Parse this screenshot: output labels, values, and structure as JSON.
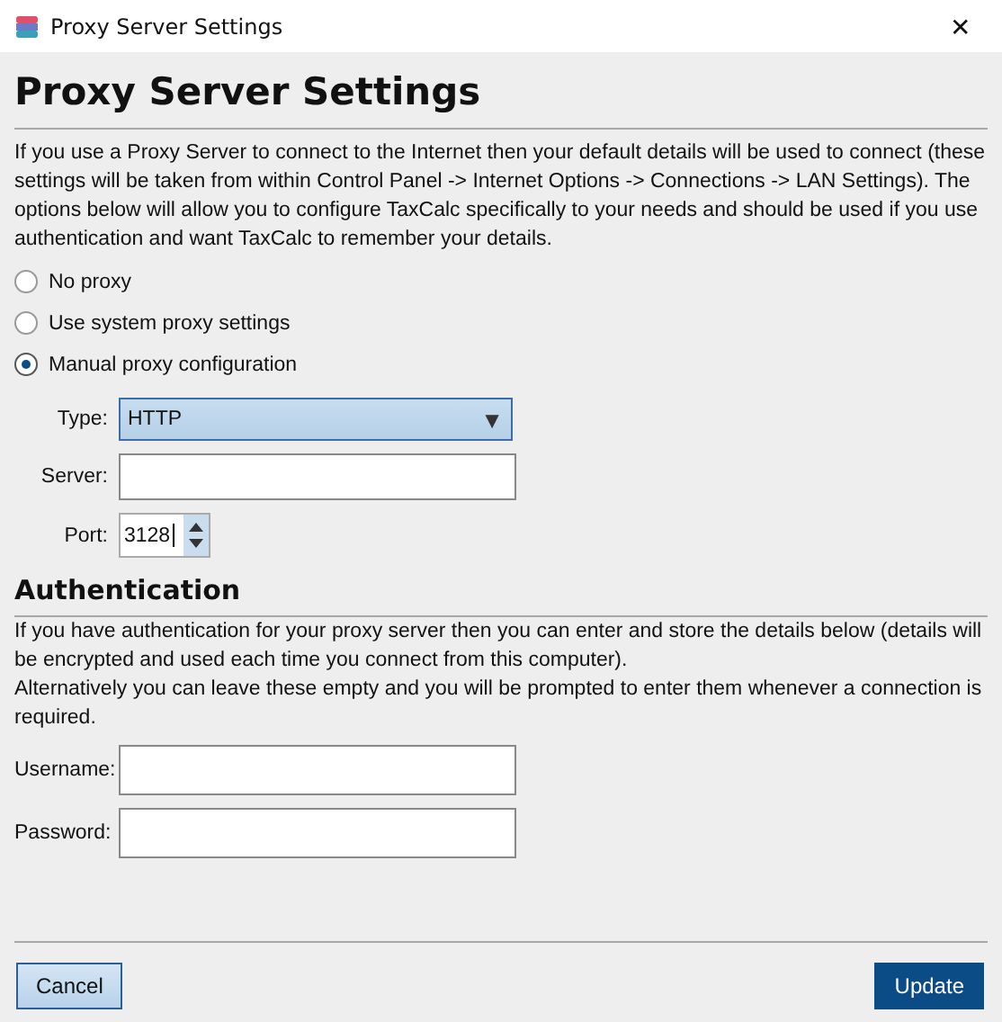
{
  "window": {
    "title": "Proxy Server Settings",
    "close": "✕"
  },
  "heading": "Proxy Server Settings",
  "intro": "If you use a Proxy Server to connect to the Internet then your default details will be used to connect (these settings will be taken from within Control Panel -> Internet Options -> Connections -> LAN Settings). The options below will allow you to configure TaxCalc specifically to your needs and should be used if you use authentication and want TaxCalc to remember your details.",
  "proxy_options": [
    {
      "label": "No proxy",
      "selected": false
    },
    {
      "label": "Use system proxy settings",
      "selected": false
    },
    {
      "label": "Manual proxy configuration",
      "selected": true
    }
  ],
  "type": {
    "label": "Type:",
    "value": "HTTP",
    "arrow": "▼"
  },
  "server": {
    "label": "Server:"
  },
  "port": {
    "label": "Port:",
    "value": "3128"
  },
  "auth_heading": "Authentication",
  "auth_text": [
    "If you have authentication for your proxy server then you can enter and store the details below (details will be encrypted and used each time you connect from this computer).",
    "Alternatively you can leave these empty and you will be prompted to enter them whenever a connection is required."
  ],
  "username": {
    "label": "Username:"
  },
  "password": {
    "label": "Password:"
  },
  "buttons": [
    {
      "label": "Cancel",
      "kind": "secondary"
    },
    {
      "label": "Update",
      "kind": "primary"
    }
  ]
}
